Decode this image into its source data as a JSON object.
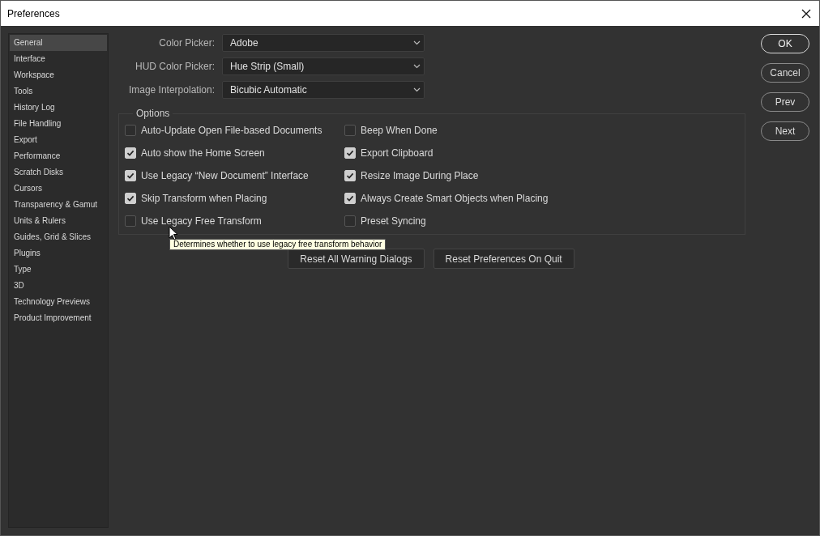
{
  "window": {
    "title": "Preferences"
  },
  "sidebar": {
    "items": [
      {
        "label": "General",
        "selected": true
      },
      {
        "label": "Interface",
        "selected": false
      },
      {
        "label": "Workspace",
        "selected": false
      },
      {
        "label": "Tools",
        "selected": false
      },
      {
        "label": "History Log",
        "selected": false
      },
      {
        "label": "File Handling",
        "selected": false
      },
      {
        "label": "Export",
        "selected": false
      },
      {
        "label": "Performance",
        "selected": false
      },
      {
        "label": "Scratch Disks",
        "selected": false
      },
      {
        "label": "Cursors",
        "selected": false
      },
      {
        "label": "Transparency & Gamut",
        "selected": false
      },
      {
        "label": "Units & Rulers",
        "selected": false
      },
      {
        "label": "Guides, Grid & Slices",
        "selected": false
      },
      {
        "label": "Plugins",
        "selected": false
      },
      {
        "label": "Type",
        "selected": false
      },
      {
        "label": "3D",
        "selected": false
      },
      {
        "label": "Technology Previews",
        "selected": false
      },
      {
        "label": "Product Improvement",
        "selected": false
      }
    ]
  },
  "pickers": [
    {
      "label": "Color Picker:",
      "value": "Adobe"
    },
    {
      "label": "HUD Color Picker:",
      "value": "Hue Strip (Small)"
    },
    {
      "label": "Image Interpolation:",
      "value": "Bicubic Automatic"
    }
  ],
  "options": {
    "title": "Options",
    "items": [
      {
        "label": "Auto-Update Open File-based Documents",
        "checked": false
      },
      {
        "label": "Beep When Done",
        "checked": false
      },
      {
        "label": "Auto show the Home Screen",
        "checked": true
      },
      {
        "label": "Export Clipboard",
        "checked": true
      },
      {
        "label": "Use Legacy “New Document” Interface",
        "checked": true
      },
      {
        "label": "Resize Image During Place",
        "checked": true
      },
      {
        "label": "Skip Transform when Placing",
        "checked": true
      },
      {
        "label": "Always Create Smart Objects when Placing",
        "checked": true
      },
      {
        "label": "Use Legacy Free Transform",
        "checked": false
      },
      {
        "label": "Preset Syncing",
        "checked": false
      }
    ]
  },
  "tooltip": "Determines whether to use legacy free transform behavior",
  "reset_buttons": [
    "Reset All Warning Dialogs",
    "Reset Preferences On Quit"
  ],
  "dialog_buttons": [
    {
      "label": "OK",
      "default": true
    },
    {
      "label": "Cancel",
      "default": false
    },
    {
      "label": "Prev",
      "default": false
    },
    {
      "label": "Next",
      "default": false
    }
  ]
}
